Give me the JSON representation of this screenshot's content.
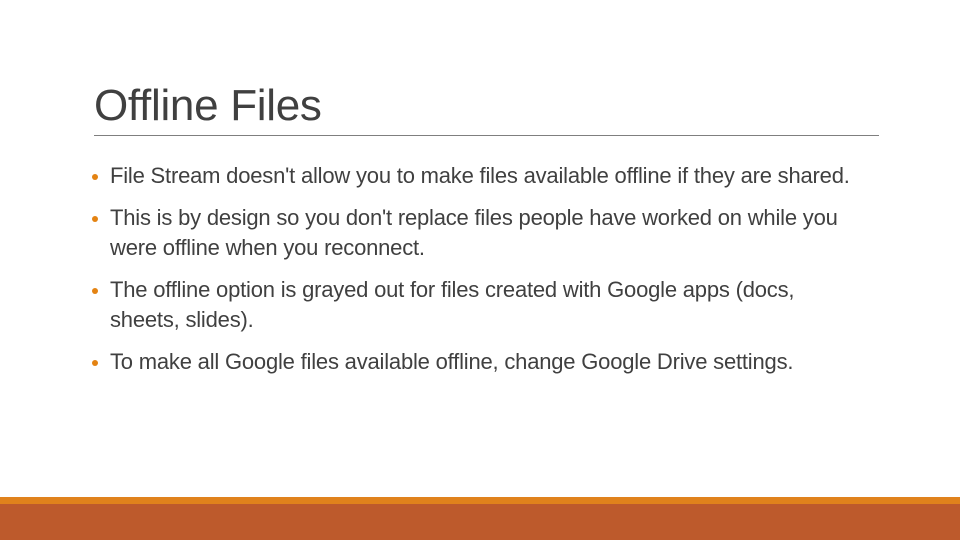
{
  "slide": {
    "title": "Offline Files",
    "bullets": [
      "File Stream doesn't allow you to make files available offline if they are shared.",
      "This is by design so you don't replace files people have worked on while you were offline when you reconnect.",
      "The offline option is grayed out for files created with Google apps (docs, sheets, slides).",
      "To make all Google files available offline, change Google Drive settings."
    ]
  },
  "colors": {
    "accent_bullet": "#e48312",
    "band_orange": "#e0821c",
    "band_rust": "#bd5a2c",
    "text": "#404040"
  }
}
